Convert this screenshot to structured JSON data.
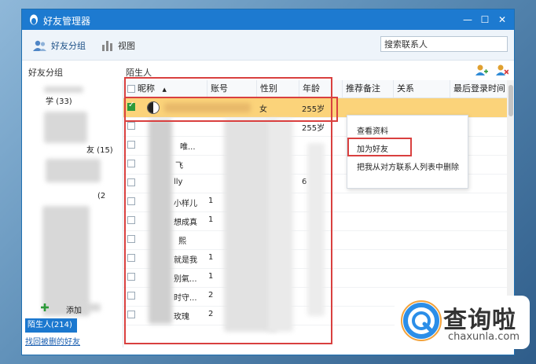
{
  "window": {
    "title": "好友管理器",
    "min": "—",
    "max": "☐",
    "close": "✕"
  },
  "toolbar": {
    "groups_label": "好友分组",
    "view_label": "视图",
    "search_placeholder": "搜索联系人"
  },
  "sidebar": {
    "title": "好友分组",
    "groups": [
      "学 (33)",
      "友 (15)",
      "(2",
      "添加",
      "陌生人(214)"
    ],
    "selected": "陌生人(214)",
    "recover_link": "找回被删的好友"
  },
  "main": {
    "title": "陌生人",
    "columns": [
      "昵称",
      "账号",
      "性别",
      "年龄",
      "推荐备注",
      "关系",
      "最后登录时间"
    ],
    "sort_indicator": "▲",
    "rows": [
      {
        "nick": "",
        "gender": "女",
        "age": "255岁",
        "checked": true
      },
      {
        "nick": "",
        "gender": "",
        "age": "255岁",
        "checked": false
      },
      {
        "nick": "唯...",
        "gender": "",
        "age": "",
        "checked": false
      },
      {
        "nick": "飞",
        "gender": "",
        "age": "",
        "checked": false
      },
      {
        "nick": "lly",
        "gender": "",
        "age": "6",
        "checked": false
      },
      {
        "nick": "小样儿",
        "account": "1",
        "gender": "",
        "age": "",
        "checked": false
      },
      {
        "nick": "想成真",
        "account": "1",
        "gender": "",
        "age": "",
        "checked": false
      },
      {
        "nick": "熙",
        "gender": "",
        "age": "",
        "checked": false
      },
      {
        "nick": "就是我",
        "account": "1",
        "gender": "",
        "age": "",
        "checked": false
      },
      {
        "nick": "别氣...",
        "account": "1",
        "gender": "",
        "age": "",
        "checked": false
      },
      {
        "nick": "时守...",
        "account": "2",
        "gender": "",
        "age": "",
        "checked": false
      },
      {
        "nick": "玫瑰",
        "account": "2",
        "gender": "",
        "age": "",
        "checked": false
      }
    ]
  },
  "context_menu": {
    "items": [
      "查看资料",
      "加为好友",
      "把我从对方联系人列表中删除"
    ]
  },
  "watermark": {
    "cn": "查询啦",
    "en": "chaxunla.com"
  },
  "colors": {
    "titlebar": "#1d7ad0",
    "selected_row": "#fbd37a",
    "highlight": "#d9403f",
    "selected_group": "#1b78cf"
  }
}
